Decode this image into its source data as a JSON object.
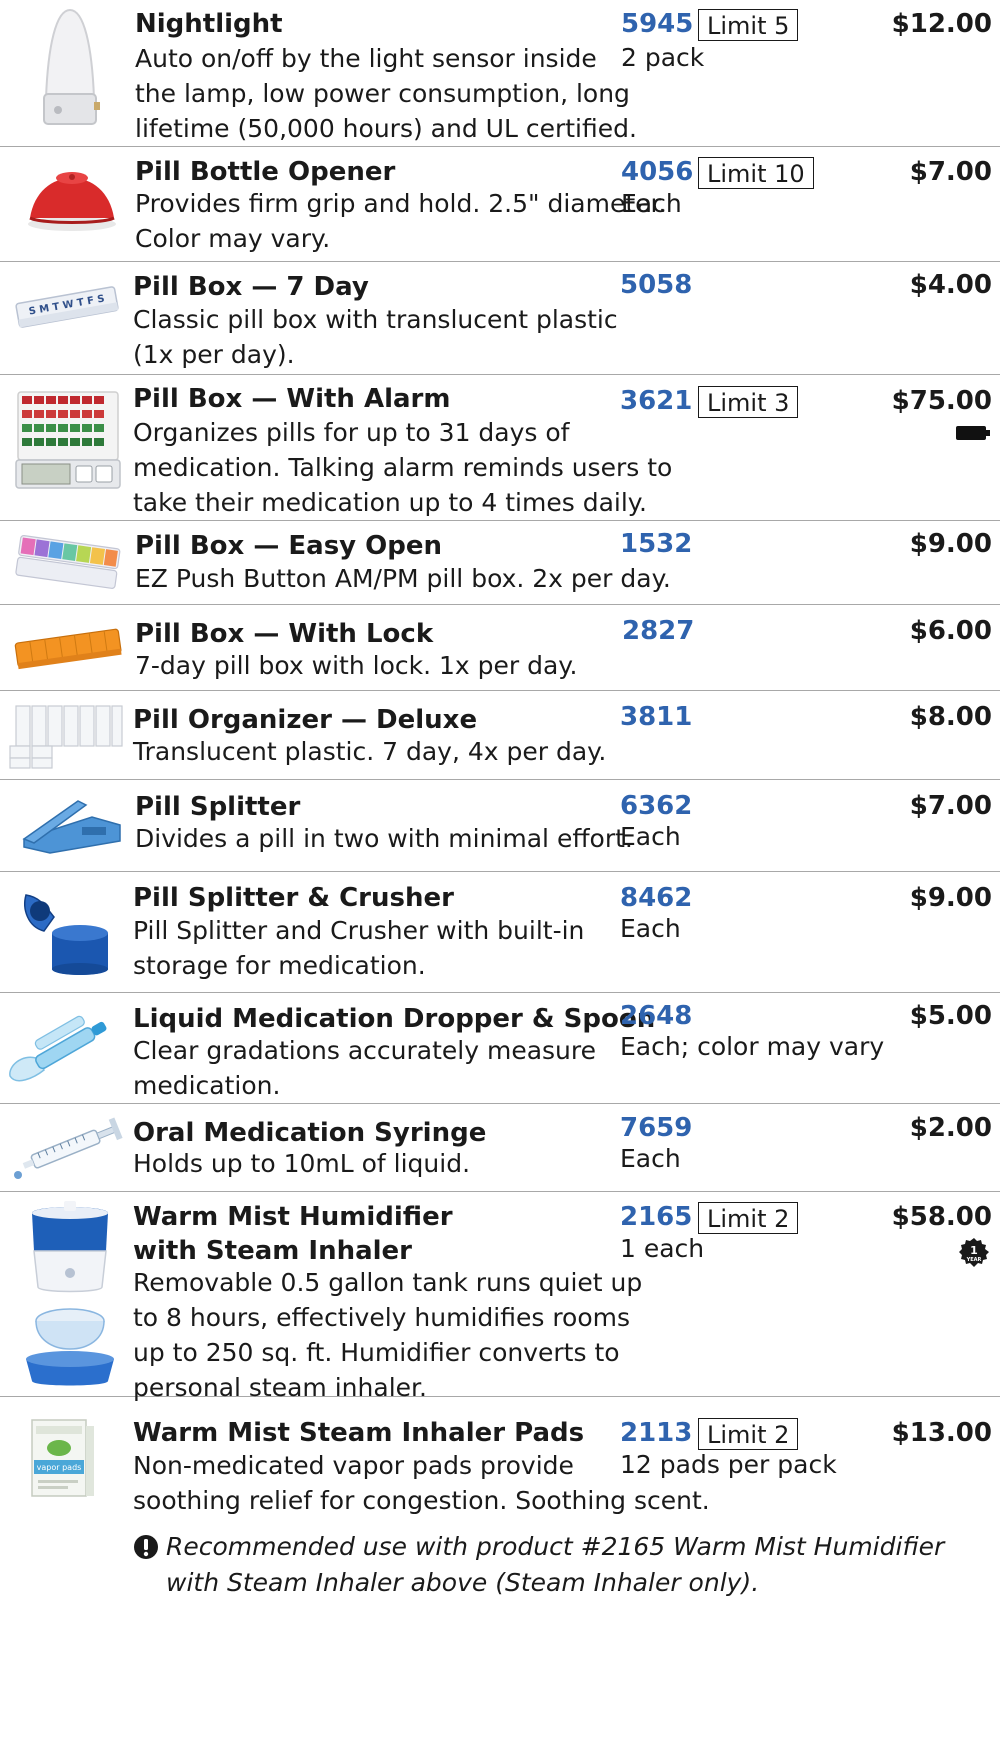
{
  "products": [
    {
      "name": "Nightlight",
      "desc": [
        "Auto on/off by the light sensor inside",
        "the lamp, low power consumption, long",
        "lifetime (50,000 hours) and UL certified."
      ],
      "code": "5945",
      "limit": "Limit 5",
      "unit": "2 pack",
      "price": "$12.00",
      "thumb_icon": "nightlight-icon"
    },
    {
      "name": "Pill Bottle Opener",
      "desc": [
        "Provides firm grip and hold. 2.5\" diameter.",
        "Color may vary."
      ],
      "code": "4056",
      "limit": "Limit 10",
      "unit": "Each",
      "price": "$7.00",
      "thumb_icon": "bottle-opener-icon"
    },
    {
      "name": "Pill Box — 7 Day",
      "desc": [
        "Classic pill box with translucent plastic",
        "(1x per day)."
      ],
      "code": "5058",
      "price": "$4.00",
      "thumb_icon": "pill-box-icon",
      "thumb_text": "S M T W T F S"
    },
    {
      "name": "Pill Box — With Alarm",
      "desc": [
        "Organizes pills for up to 31 days of",
        "medication. Talking alarm reminds users to",
        "take their medication up to 4 times daily."
      ],
      "code": "3621",
      "limit": "Limit 3",
      "price": "$75.00",
      "badge_icon": "battery-icon",
      "thumb_icon": "alarm-pill-box-icon"
    },
    {
      "name": "Pill Box — Easy Open",
      "desc": [
        "EZ Push Button AM/PM pill box. 2x per day."
      ],
      "code": "1532",
      "price": "$9.00",
      "thumb_icon": "rainbow-pill-box-icon"
    },
    {
      "name": "Pill Box — With Lock",
      "desc": [
        "7-day pill box with lock. 1x per day."
      ],
      "code": "2827",
      "price": "$6.00",
      "thumb_icon": "lock-pill-box-icon"
    },
    {
      "name": "Pill Organizer — Deluxe",
      "desc": [
        "Translucent plastic. 7 day, 4x per day."
      ],
      "code": "3811",
      "price": "$8.00",
      "thumb_icon": "pill-organizer-icon"
    },
    {
      "name": "Pill Splitter",
      "desc": [
        "Divides a pill in two with minimal effort."
      ],
      "code": "6362",
      "unit": "Each",
      "price": "$7.00",
      "thumb_icon": "pill-splitter-icon"
    },
    {
      "name": "Pill Splitter & Crusher",
      "desc": [
        "Pill Splitter and Crusher with built-in",
        "storage for medication."
      ],
      "code": "8462",
      "unit": "Each",
      "price": "$9.00",
      "thumb_icon": "splitter-crusher-icon"
    },
    {
      "name": "Liquid Medication Dropper & Spoon",
      "desc": [
        "Clear gradations accurately measure",
        "medication."
      ],
      "code": "2648",
      "unit": "Each; color may vary",
      "price": "$5.00",
      "thumb_icon": "dropper-spoon-icon"
    },
    {
      "name": "Oral Medication Syringe",
      "desc": [
        "Holds up to 10mL of liquid."
      ],
      "code": "7659",
      "unit": "Each",
      "price": "$2.00",
      "thumb_icon": "syringe-icon"
    },
    {
      "name": [
        "Warm Mist Humidifier",
        "with Steam Inhaler"
      ],
      "desc": [
        "Removable 0.5 gallon tank runs quiet up",
        "to 8 hours, effectively humidifies rooms",
        "up to 250 sq. ft. Humidifier converts to",
        "personal steam inhaler."
      ],
      "code": "2165",
      "limit": "Limit 2",
      "unit": "1 each",
      "price": "$58.00",
      "badge_icon": "warranty-seal-icon",
      "badge_text": [
        "1",
        "YEAR"
      ],
      "thumb_icon": "humidifier-icon"
    },
    {
      "name": "Warm Mist Steam Inhaler Pads",
      "desc": [
        "Non-medicated vapor pads provide",
        "soothing relief for congestion. Soothing scent."
      ],
      "code": "2113",
      "limit": "Limit 2",
      "unit": "12 pads per pack",
      "price": "$13.00",
      "thumb_icon": "vapor-pads-box-icon",
      "thumb_text": "vapor pads",
      "note_icon": "alert-icon",
      "note": [
        "Recommended use with product #2165 Warm Mist Humidifier",
        "with Steam Inhaler above (Steam Inhaler only)."
      ]
    }
  ]
}
